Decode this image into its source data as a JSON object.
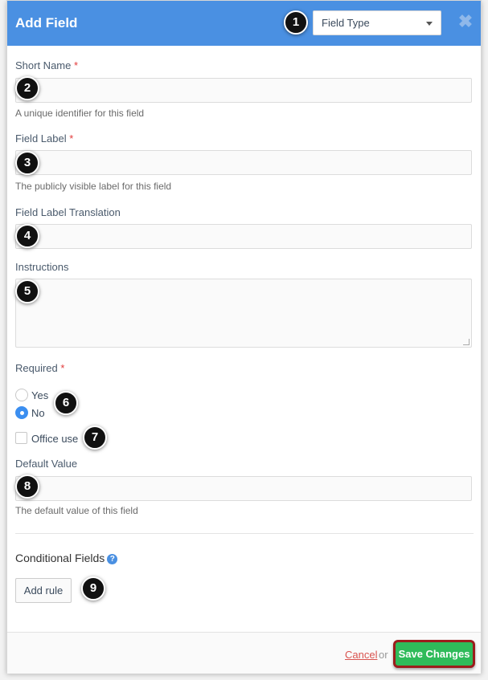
{
  "header": {
    "title": "Add Field",
    "field_type": "Field Type",
    "close_icon": "close-icon"
  },
  "form": {
    "short_name": {
      "label": "Short Name",
      "required": "*",
      "hint": "A unique identifier for this field",
      "value": ""
    },
    "field_label": {
      "label": "Field Label",
      "required": "*",
      "hint": "The publicly visible label for this field",
      "value": ""
    },
    "field_label_translation": {
      "label": "Field Label Translation",
      "value": ""
    },
    "instructions": {
      "label": "Instructions",
      "value": ""
    },
    "required": {
      "label": "Required",
      "required": "*",
      "options": [
        "Yes",
        "No"
      ],
      "selected": "No"
    },
    "office_use": {
      "label": "Office use",
      "checked": false
    },
    "default_value": {
      "label": "Default Value",
      "hint": "The default value of this field",
      "value": ""
    }
  },
  "conditional": {
    "title": "Conditional Fields",
    "help_icon": "?",
    "add_rule": "Add rule"
  },
  "footer": {
    "cancel": "Cancel",
    "or": "or",
    "save": "Save Changes"
  },
  "badges": [
    "1",
    "2",
    "3",
    "4",
    "5",
    "6",
    "7",
    "8",
    "9"
  ],
  "colors": {
    "header": "#4a90e2",
    "save": "#2fbb5a",
    "save_outline": "#9c1c1c",
    "cancel": "#d9534f",
    "required": "#e23b3b"
  }
}
